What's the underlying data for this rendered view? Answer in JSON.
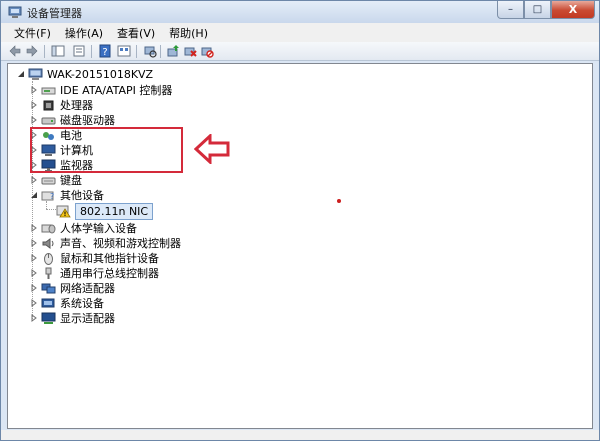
{
  "window": {
    "title": "设备管理器"
  },
  "caption": {
    "minimize": "–",
    "maximize": "□",
    "close": "X"
  },
  "menu": [
    "文件(F)",
    "操作(A)",
    "查看(V)",
    "帮助(H)"
  ],
  "toolbar": [
    "back-icon",
    "forward-icon",
    "properties-icon",
    "show-hide-console-tree-icon",
    "help-icon",
    "view-icon",
    "scan-hardware-icon",
    "update-driver-icon",
    "uninstall-icon",
    "disable-icon"
  ],
  "tree": {
    "root": "WAK-20151018KVZ",
    "items": [
      {
        "label": "IDE ATA/ATAPI 控制器",
        "icon": "ide-controller-icon",
        "expanded": false
      },
      {
        "label": "处理器",
        "icon": "processor-icon",
        "expanded": false
      },
      {
        "label": "磁盘驱动器",
        "icon": "disk-drive-icon",
        "expanded": false
      },
      {
        "label": "电池",
        "icon": "battery-icon",
        "expanded": false
      },
      {
        "label": "计算机",
        "icon": "computer-icon",
        "expanded": false
      },
      {
        "label": "监视器",
        "icon": "monitor-icon",
        "expanded": false
      },
      {
        "label": "键盘",
        "icon": "keyboard-icon",
        "expanded": false
      },
      {
        "label": "其他设备",
        "icon": "other-devices-icon",
        "expanded": true,
        "children": [
          {
            "label": "802.11n NIC",
            "icon": "warning-device-icon",
            "selected": true
          }
        ]
      },
      {
        "label": "人体学输入设备",
        "icon": "hid-icon",
        "expanded": false
      },
      {
        "label": "声音、视频和游戏控制器",
        "icon": "sound-icon",
        "expanded": false
      },
      {
        "label": "鼠标和其他指针设备",
        "icon": "mouse-icon",
        "expanded": false
      },
      {
        "label": "通用串行总线控制器",
        "icon": "usb-icon",
        "expanded": false
      },
      {
        "label": "网络适配器",
        "icon": "network-adapter-icon",
        "expanded": false
      },
      {
        "label": "系统设备",
        "icon": "system-devices-icon",
        "expanded": false
      },
      {
        "label": "显示适配器",
        "icon": "display-adapter-icon",
        "expanded": false
      }
    ]
  },
  "colors": {
    "annotation_red": "#d42a3a",
    "selection_bg": "#dce9f8"
  }
}
